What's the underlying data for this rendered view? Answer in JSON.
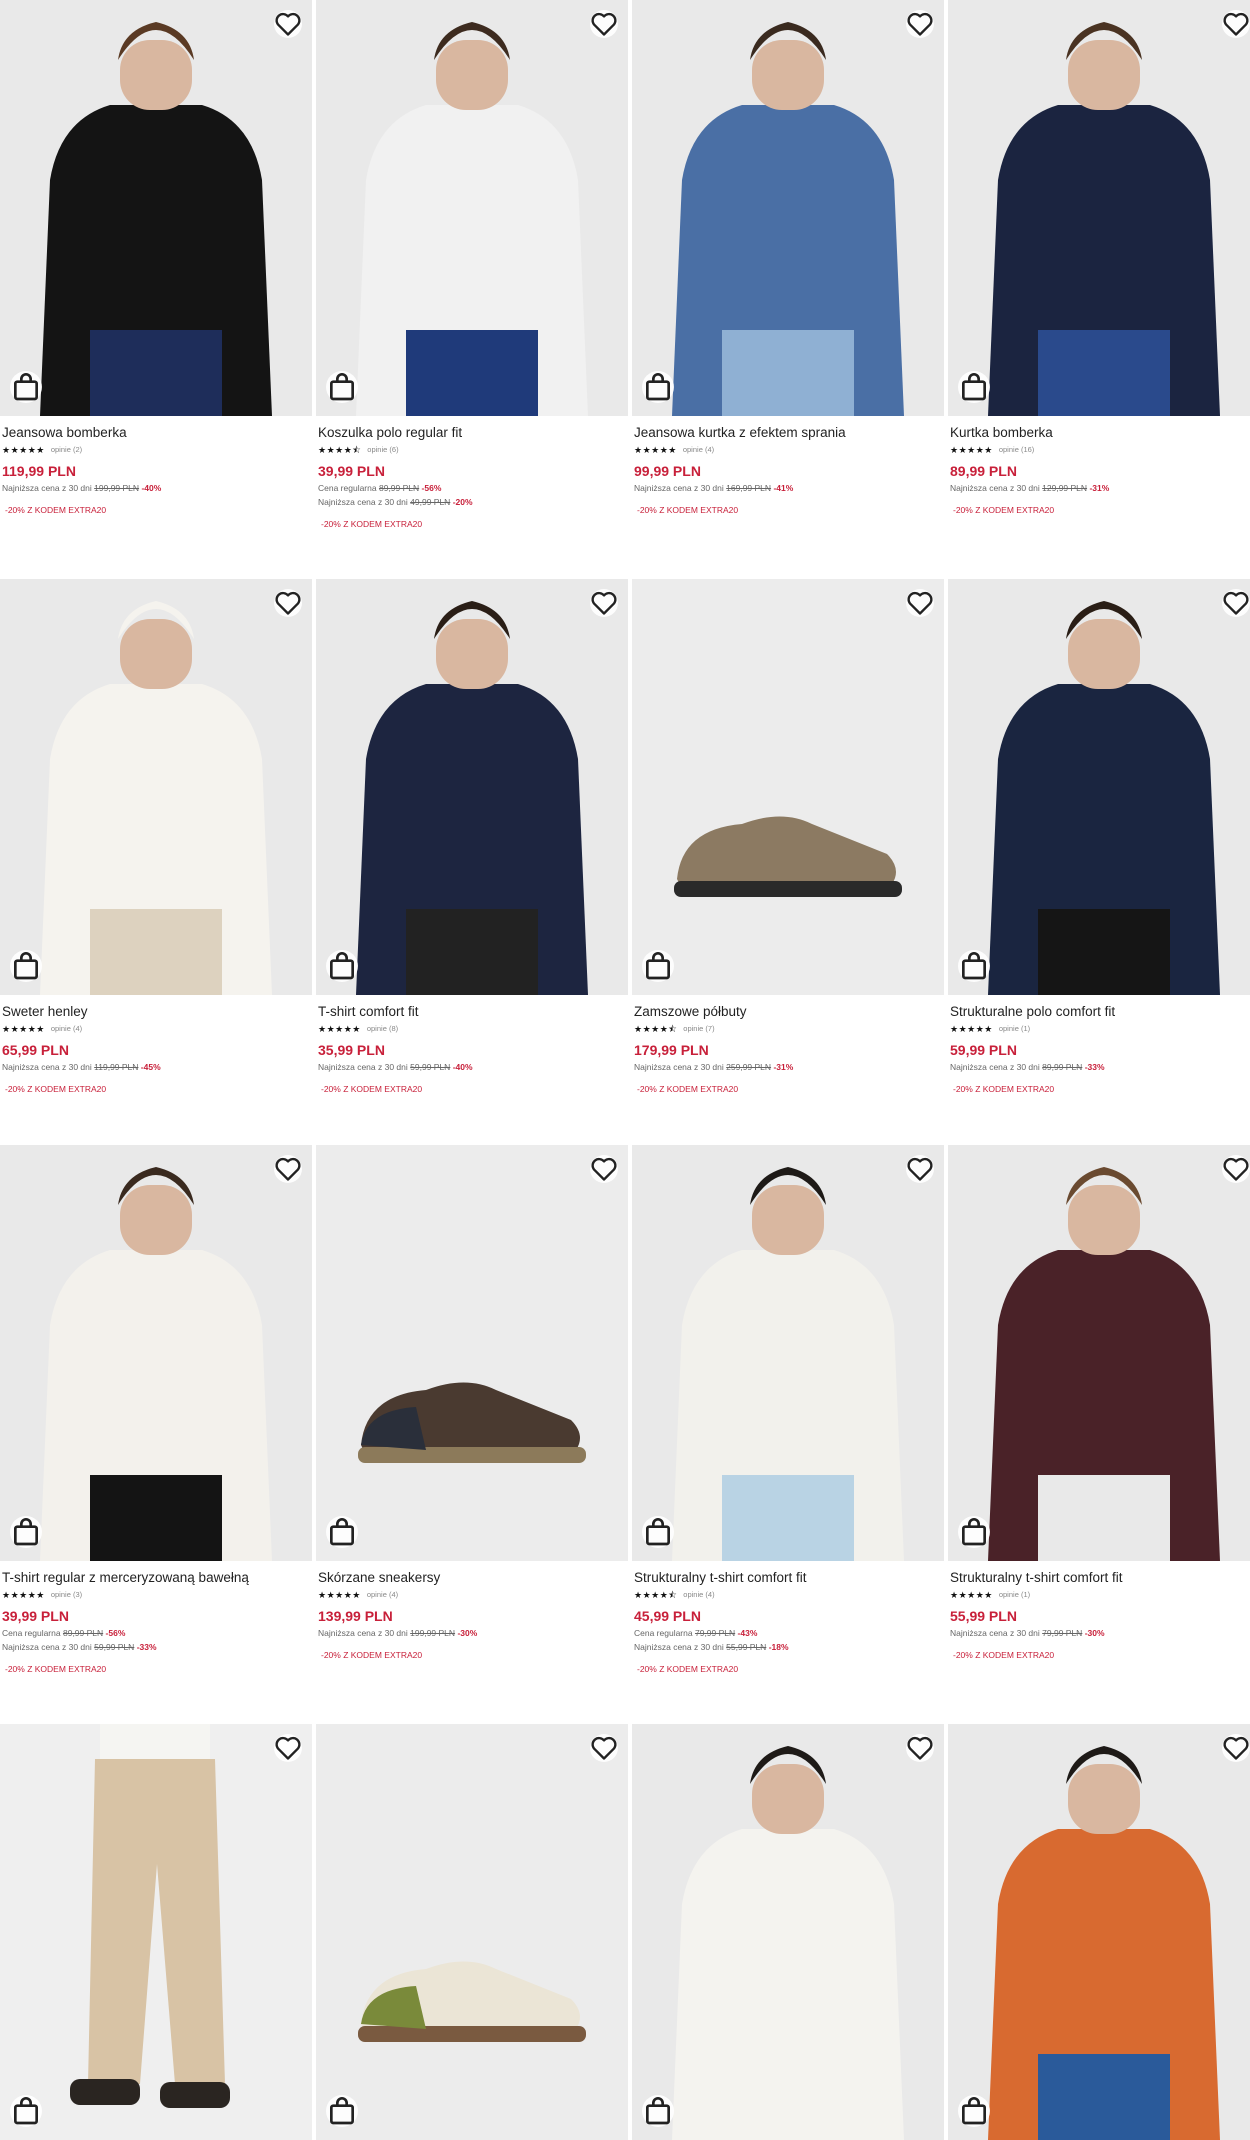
{
  "colors": {
    "price": "#c8203a",
    "discount": "#c8203a",
    "promo": "#c8203a",
    "text": "#222222",
    "muted": "#666666"
  },
  "icons": {
    "favorite": "heart-icon",
    "add_to_cart": "shopping-bag-icon",
    "rating": "star-icon"
  },
  "products": [
    {
      "title": "Jeansowa bomberka",
      "rating": 5,
      "reviews": "opinie (2)",
      "price": "119,99 PLN",
      "lines": [
        {
          "label": "Najniższa cena z 30 dni",
          "old": "199,99 PLN",
          "disc": "-40%"
        }
      ],
      "promo": "-20% Z KODEM EXTRA20",
      "image": "black bomber jacket on model"
    },
    {
      "title": "Koszulka polo regular fit",
      "rating": 4.5,
      "reviews": "opinie (6)",
      "price": "39,99 PLN",
      "lines": [
        {
          "label": "Cena regularna",
          "old": "89,99 PLN",
          "disc": "-56%"
        },
        {
          "label": "Najniższa cena z 30 dni",
          "old": "49,99 PLN",
          "disc": "-20%"
        }
      ],
      "promo": "-20% Z KODEM EXTRA20",
      "image": "white polo shirt on model"
    },
    {
      "title": "Jeansowa kurtka z efektem sprania",
      "rating": 5,
      "reviews": "opinie (4)",
      "price": "99,99 PLN",
      "lines": [
        {
          "label": "Najniższa cena z 30 dni",
          "old": "169,99 PLN",
          "disc": "-41%"
        }
      ],
      "promo": "-20% Z KODEM EXTRA20",
      "image": "denim jacket on seated model"
    },
    {
      "title": "Kurtka bomberka",
      "rating": 5,
      "reviews": "opinie (16)",
      "price": "89,99 PLN",
      "lines": [
        {
          "label": "Najniższa cena z 30 dni",
          "old": "129,99 PLN",
          "disc": "-31%"
        }
      ],
      "promo": "-20% Z KODEM EXTRA20",
      "image": "navy bomber jacket on model"
    },
    {
      "title": "Sweter henley",
      "rating": 5,
      "reviews": "opinie (4)",
      "price": "65,99 PLN",
      "lines": [
        {
          "label": "Najniższa cena z 30 dni",
          "old": "119,99 PLN",
          "disc": "-45%"
        }
      ],
      "promo": "-20% Z KODEM EXTRA20",
      "image": "white henley sweater on model"
    },
    {
      "title": "T-shirt comfort fit",
      "rating": 5,
      "reviews": "opinie (8)",
      "price": "35,99 PLN",
      "lines": [
        {
          "label": "Najniższa cena z 30 dni",
          "old": "59,99 PLN",
          "disc": "-40%"
        }
      ],
      "promo": "-20% Z KODEM EXTRA20",
      "image": "navy patterned t-shirt on model"
    },
    {
      "title": "Zamszowe półbuty",
      "rating": 4.5,
      "reviews": "opinie (7)",
      "price": "179,99 PLN",
      "lines": [
        {
          "label": "Najniższa cena z 30 dni",
          "old": "259,99 PLN",
          "disc": "-31%"
        }
      ],
      "promo": "-20% Z KODEM EXTRA20",
      "image": "suede derby shoe"
    },
    {
      "title": "Strukturalne polo comfort fit",
      "rating": 5,
      "reviews": "opinie (1)",
      "price": "59,99 PLN",
      "lines": [
        {
          "label": "Najniższa cena z 30 dni",
          "old": "89,99 PLN",
          "disc": "-33%"
        }
      ],
      "promo": "-20% Z KODEM EXTRA20",
      "image": "navy textured polo on model"
    },
    {
      "title": "T-shirt regular z merceryzowaną bawełną",
      "rating": 5,
      "reviews": "opinie (3)",
      "price": "39,99 PLN",
      "lines": [
        {
          "label": "Cena regularna",
          "old": "89,99 PLN",
          "disc": "-56%"
        },
        {
          "label": "Najniższa cena z 30 dni",
          "old": "59,99 PLN",
          "disc": "-33%"
        }
      ],
      "promo": "-20% Z KODEM EXTRA20",
      "image": "white t-shirt with emblem on model"
    },
    {
      "title": "Skórzane sneakersy",
      "rating": 5,
      "reviews": "opinie (4)",
      "price": "139,99 PLN",
      "lines": [
        {
          "label": "Najniższa cena z 30 dni",
          "old": "199,99 PLN",
          "disc": "-30%"
        }
      ],
      "promo": "-20% Z KODEM EXTRA20",
      "image": "brown leather sneaker"
    },
    {
      "title": "Strukturalny t-shirt comfort fit",
      "rating": 4.5,
      "reviews": "opinie (4)",
      "price": "45,99 PLN",
      "lines": [
        {
          "label": "Cena regularna",
          "old": "79,99 PLN",
          "disc": "-43%"
        },
        {
          "label": "Najniższa cena z 30 dni",
          "old": "55,99 PLN",
          "disc": "-18%"
        }
      ],
      "promo": "-20% Z KODEM EXTRA20",
      "image": "white textured t-shirt on model"
    },
    {
      "title": "Strukturalny t-shirt comfort fit",
      "rating": 5,
      "reviews": "opinie (1)",
      "price": "55,99 PLN",
      "lines": [
        {
          "label": "Najniższa cena z 30 dni",
          "old": "79,99 PLN",
          "disc": "-30%"
        }
      ],
      "promo": "-20% Z KODEM EXTRA20",
      "image": "burgundy textured t-shirt on model"
    },
    {
      "title": "",
      "image": "beige cargo trousers on model"
    },
    {
      "title": "",
      "image": "cream and olive sneaker"
    },
    {
      "title": "",
      "image": "white textured t-shirt close-up on model"
    },
    {
      "title": "",
      "image": "orange t-shirt on model"
    }
  ]
}
